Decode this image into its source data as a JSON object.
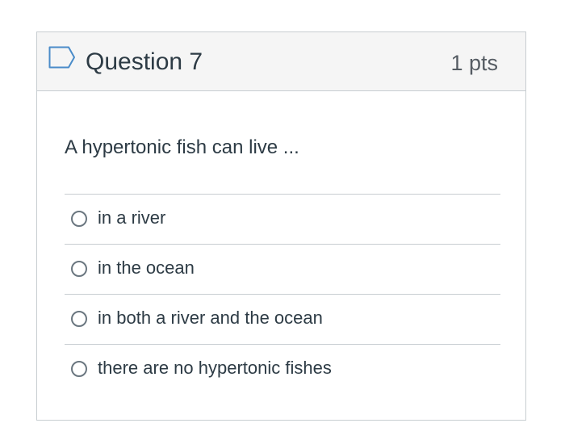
{
  "question": {
    "title": "Question 7",
    "points": "1 pts",
    "text": "A hypertonic fish can live ...",
    "flag_icon": "flag-outline-icon",
    "answers": [
      {
        "label": "in a river",
        "selected": false
      },
      {
        "label": "in the ocean",
        "selected": false
      },
      {
        "label": "in both a river and the ocean",
        "selected": false
      },
      {
        "label": "there are no hypertonic fishes",
        "selected": false
      }
    ]
  },
  "colors": {
    "header_background": "#f5f5f5",
    "border": "#c7cdd1",
    "text": "#2d3b45",
    "flag": "#4a8cc9"
  }
}
